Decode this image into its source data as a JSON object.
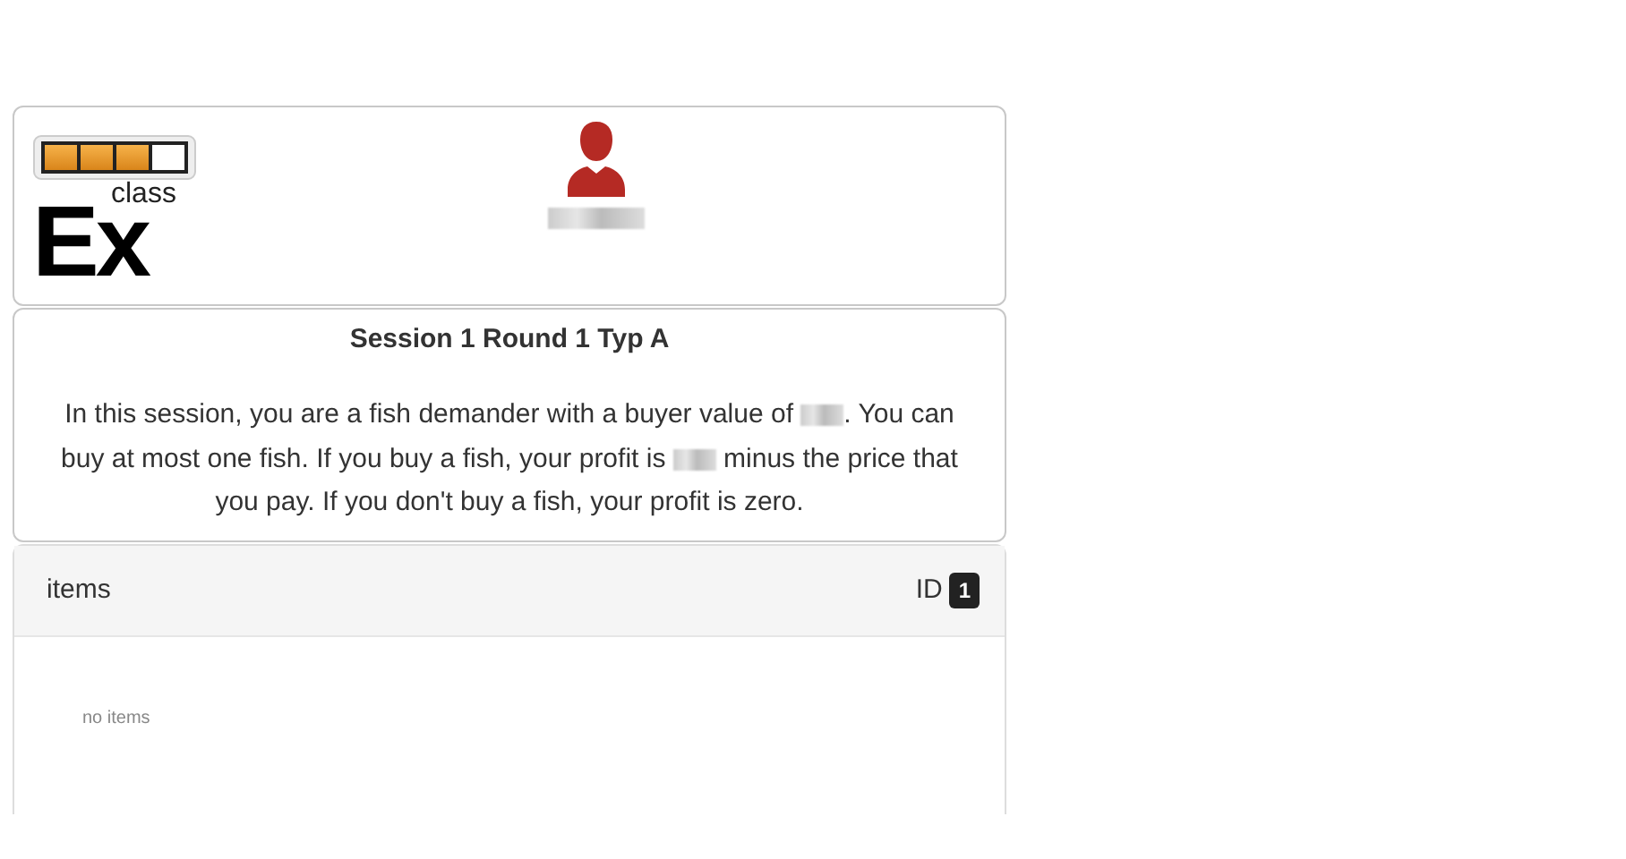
{
  "header": {
    "logo": {
      "superscript": "class",
      "letters": "Ex"
    },
    "user": {
      "label": {
        "kind": "redacted"
      }
    }
  },
  "session": {
    "title": "Session 1 Round 1 Typ A",
    "description": [
      {
        "kind": "text",
        "text": "In this session, you are a fish demander with a buyer value of "
      },
      {
        "kind": "redacted"
      },
      {
        "kind": "text",
        "text": ". You can buy at most one fish. If you buy a fish, your profit is "
      },
      {
        "kind": "redacted"
      },
      {
        "kind": "text",
        "text": " minus the price that you pay. If you don't buy a fish, your profit is zero."
      }
    ]
  },
  "items": {
    "title": "items",
    "id_label": "ID",
    "id_badge": "1",
    "empty_text": "no items"
  }
}
